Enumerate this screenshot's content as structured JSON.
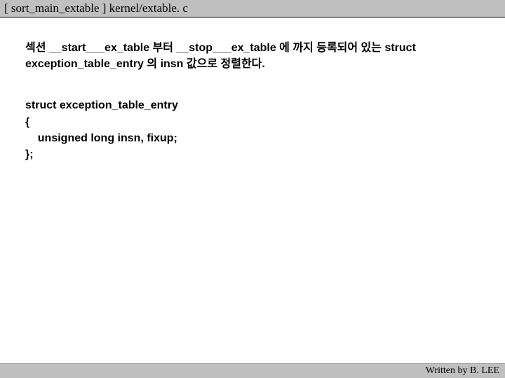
{
  "header": {
    "title": "[ sort_main_extable ] kernel/extable. c"
  },
  "body": {
    "description": "섹션 __start___ex_table 부터 __stop___ex_table 에 까지 등록되어 있는 struct exception_table_entry 의 insn 값으로 정렬한다.",
    "code": "struct exception_table_entry\n{\n    unsigned long insn, fixup;\n};"
  },
  "footer": {
    "credit": "Written by B. LEE"
  }
}
